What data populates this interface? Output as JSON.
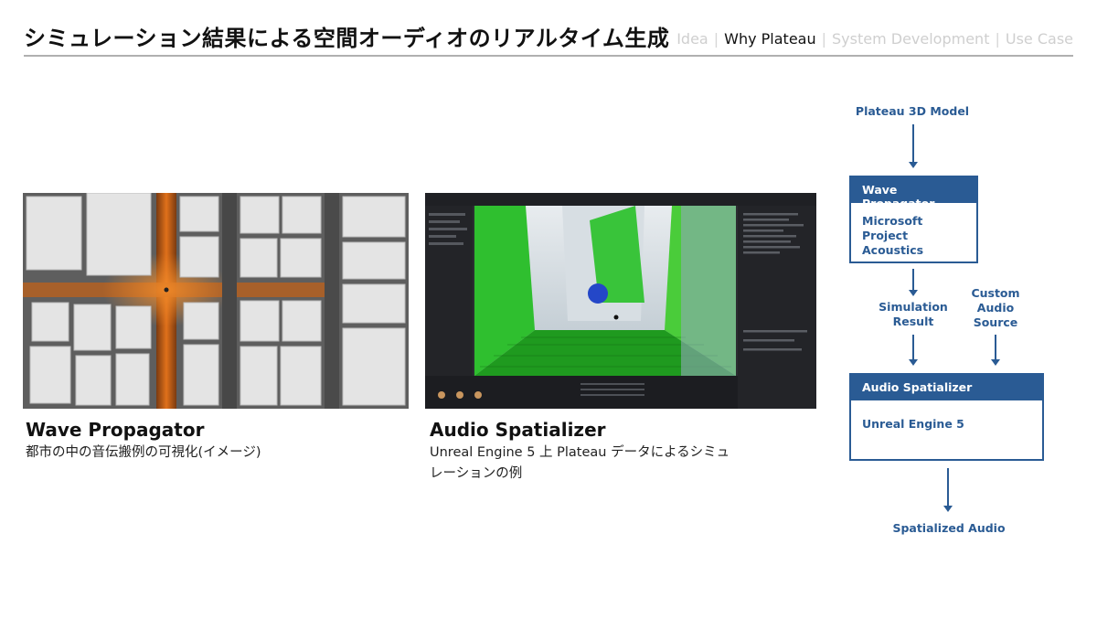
{
  "header": {
    "title": "シミュレーション結果による空間オーディオのリアルタイム生成",
    "nav": [
      {
        "label": "Idea",
        "active": false
      },
      {
        "label": "Why Plateau",
        "active": true
      },
      {
        "label": "System Development",
        "active": false
      },
      {
        "label": "Use Case",
        "active": false
      }
    ]
  },
  "left_panel": {
    "title": "Wave Propagator",
    "caption": "都市の中の音伝搬例の可視化(イメージ)"
  },
  "right_panel": {
    "title": "Audio Spatializer",
    "caption_line1": "Unreal Engine 5 上 Plateau データによるシミュ",
    "caption_line2": "レーションの例"
  },
  "diagram": {
    "top_input": "Plateau 3D Model",
    "box1": {
      "head": "Wave Propagator",
      "body_line1": "Microsoft",
      "body_line2": "Project Acoustics"
    },
    "sim_result": {
      "line1": "Simulation",
      "line2": "Result"
    },
    "custom_audio": {
      "line1": "Custom",
      "line2": "Audio",
      "line3": "Source"
    },
    "box2": {
      "head": "Audio Spatializer",
      "body": "Unreal Engine 5"
    },
    "output": "Spatialized Audio",
    "color": "#2a5b94"
  }
}
